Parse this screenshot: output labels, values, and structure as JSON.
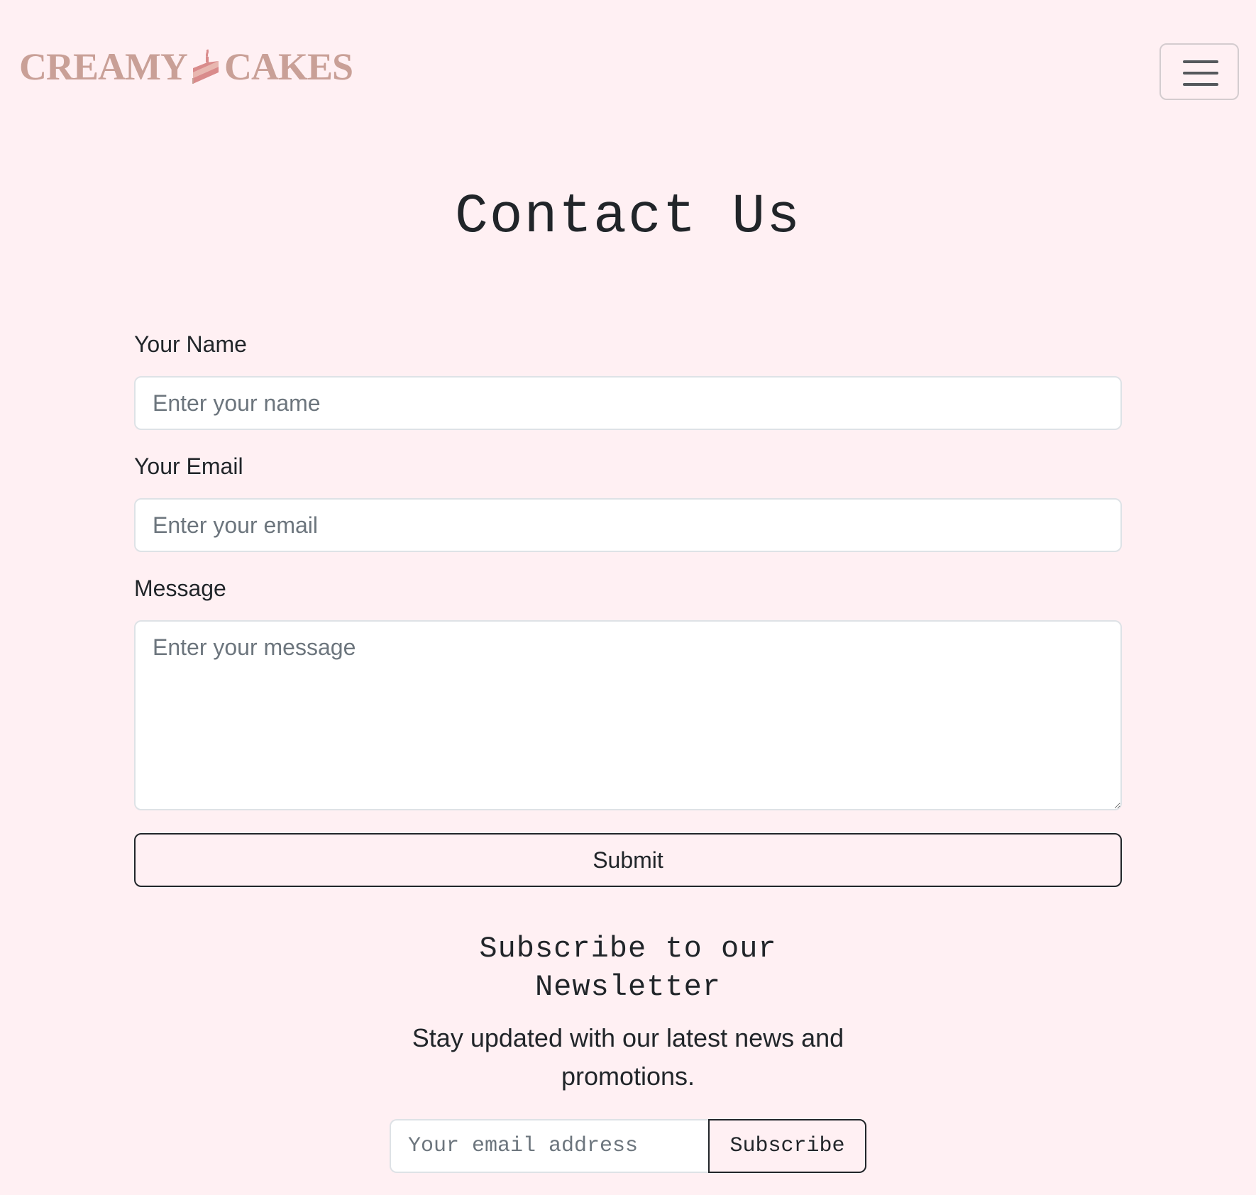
{
  "navbar": {
    "brand_left": "CREAMY",
    "brand_right": "CAKES",
    "brand_icon": "cake-slice-icon",
    "brand_color": "#c9a097",
    "toggler_icon": "hamburger-menu-icon"
  },
  "page": {
    "title": "Contact Us",
    "background": "#fff0f3"
  },
  "form": {
    "name_label": "Your Name",
    "name_placeholder": "Enter your name",
    "email_label": "Your Email",
    "email_placeholder": "Enter your email",
    "message_label": "Message",
    "message_placeholder": "Enter your message",
    "submit_label": "Submit"
  },
  "newsletter": {
    "title": "Subscribe to our Newsletter",
    "description": "Stay updated with our latest news and promotions.",
    "email_placeholder": "Your email address",
    "button_label": "Subscribe"
  }
}
